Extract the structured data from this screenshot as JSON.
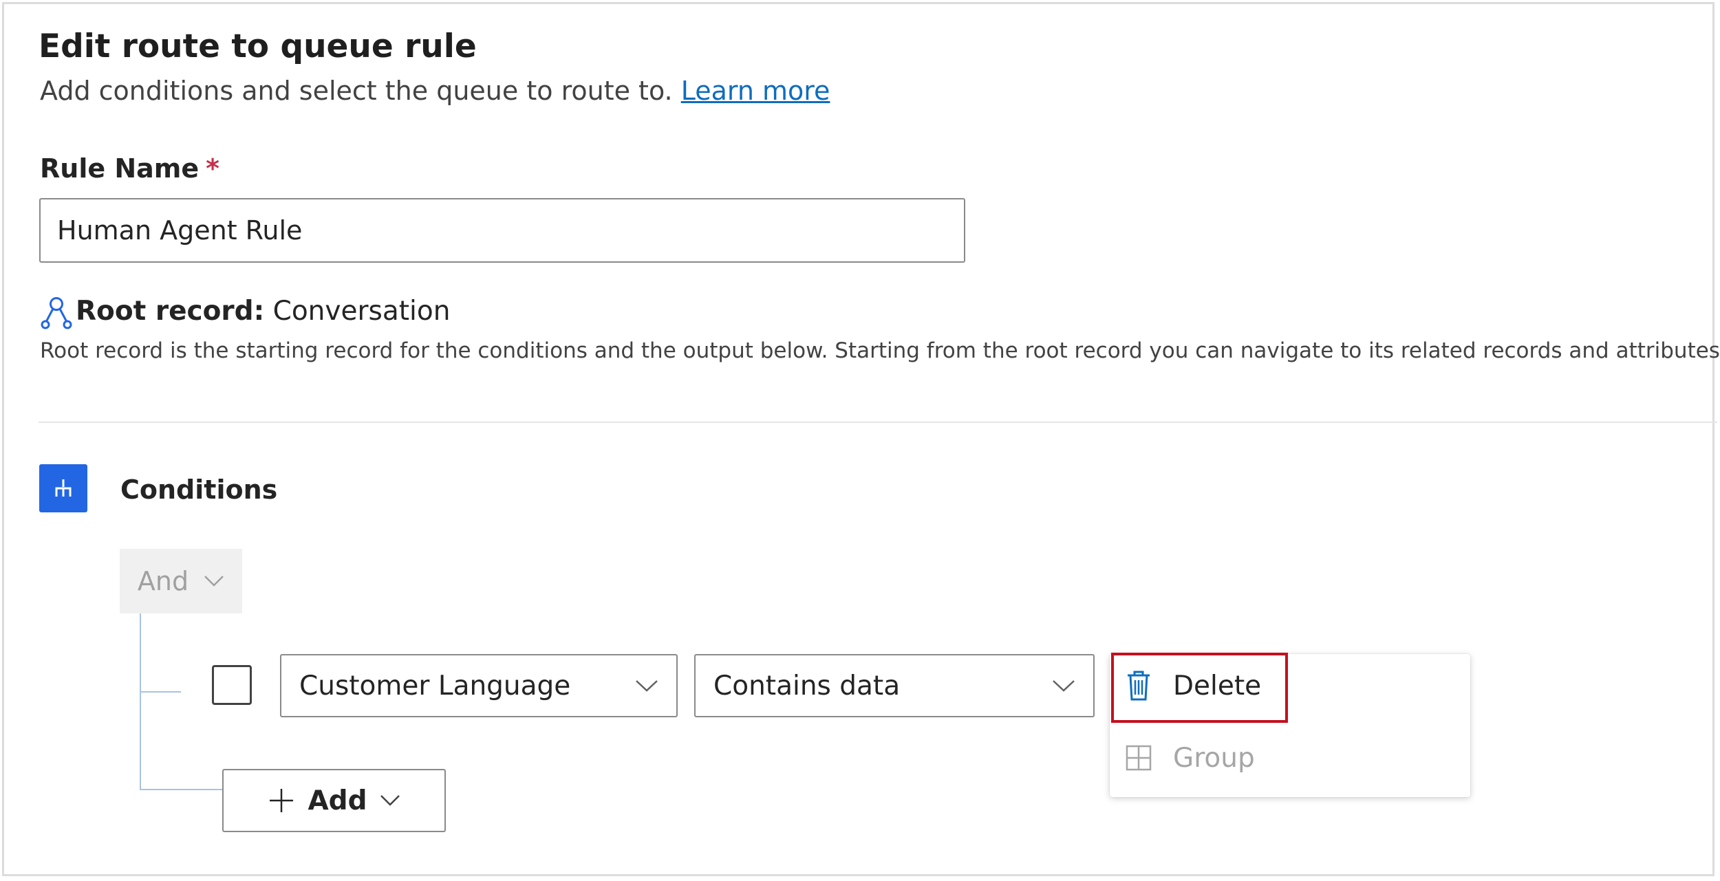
{
  "header": {
    "title": "Edit route to queue rule",
    "subtitle": "Add conditions and select the queue to route to.",
    "learn_more": "Learn more"
  },
  "rule_name": {
    "label": "Rule Name",
    "required_marker": "*",
    "value": "Human Agent Rule"
  },
  "root_record": {
    "label": "Root record:",
    "value": "Conversation",
    "description": "Root record is the starting record for the conditions and the output below. Starting from the root record you can navigate to its related records and attributes."
  },
  "conditions": {
    "title": "Conditions",
    "group_operator": "And",
    "row": {
      "field": "Customer Language",
      "operator": "Contains data"
    },
    "add_label": "Add"
  },
  "context_menu": {
    "delete_label": "Delete",
    "group_label": "Group"
  },
  "colors": {
    "accent": "#2266e3",
    "link": "#0f6cbd",
    "highlight": "#c50f1f",
    "disabled_text": "#a6a6a6"
  }
}
